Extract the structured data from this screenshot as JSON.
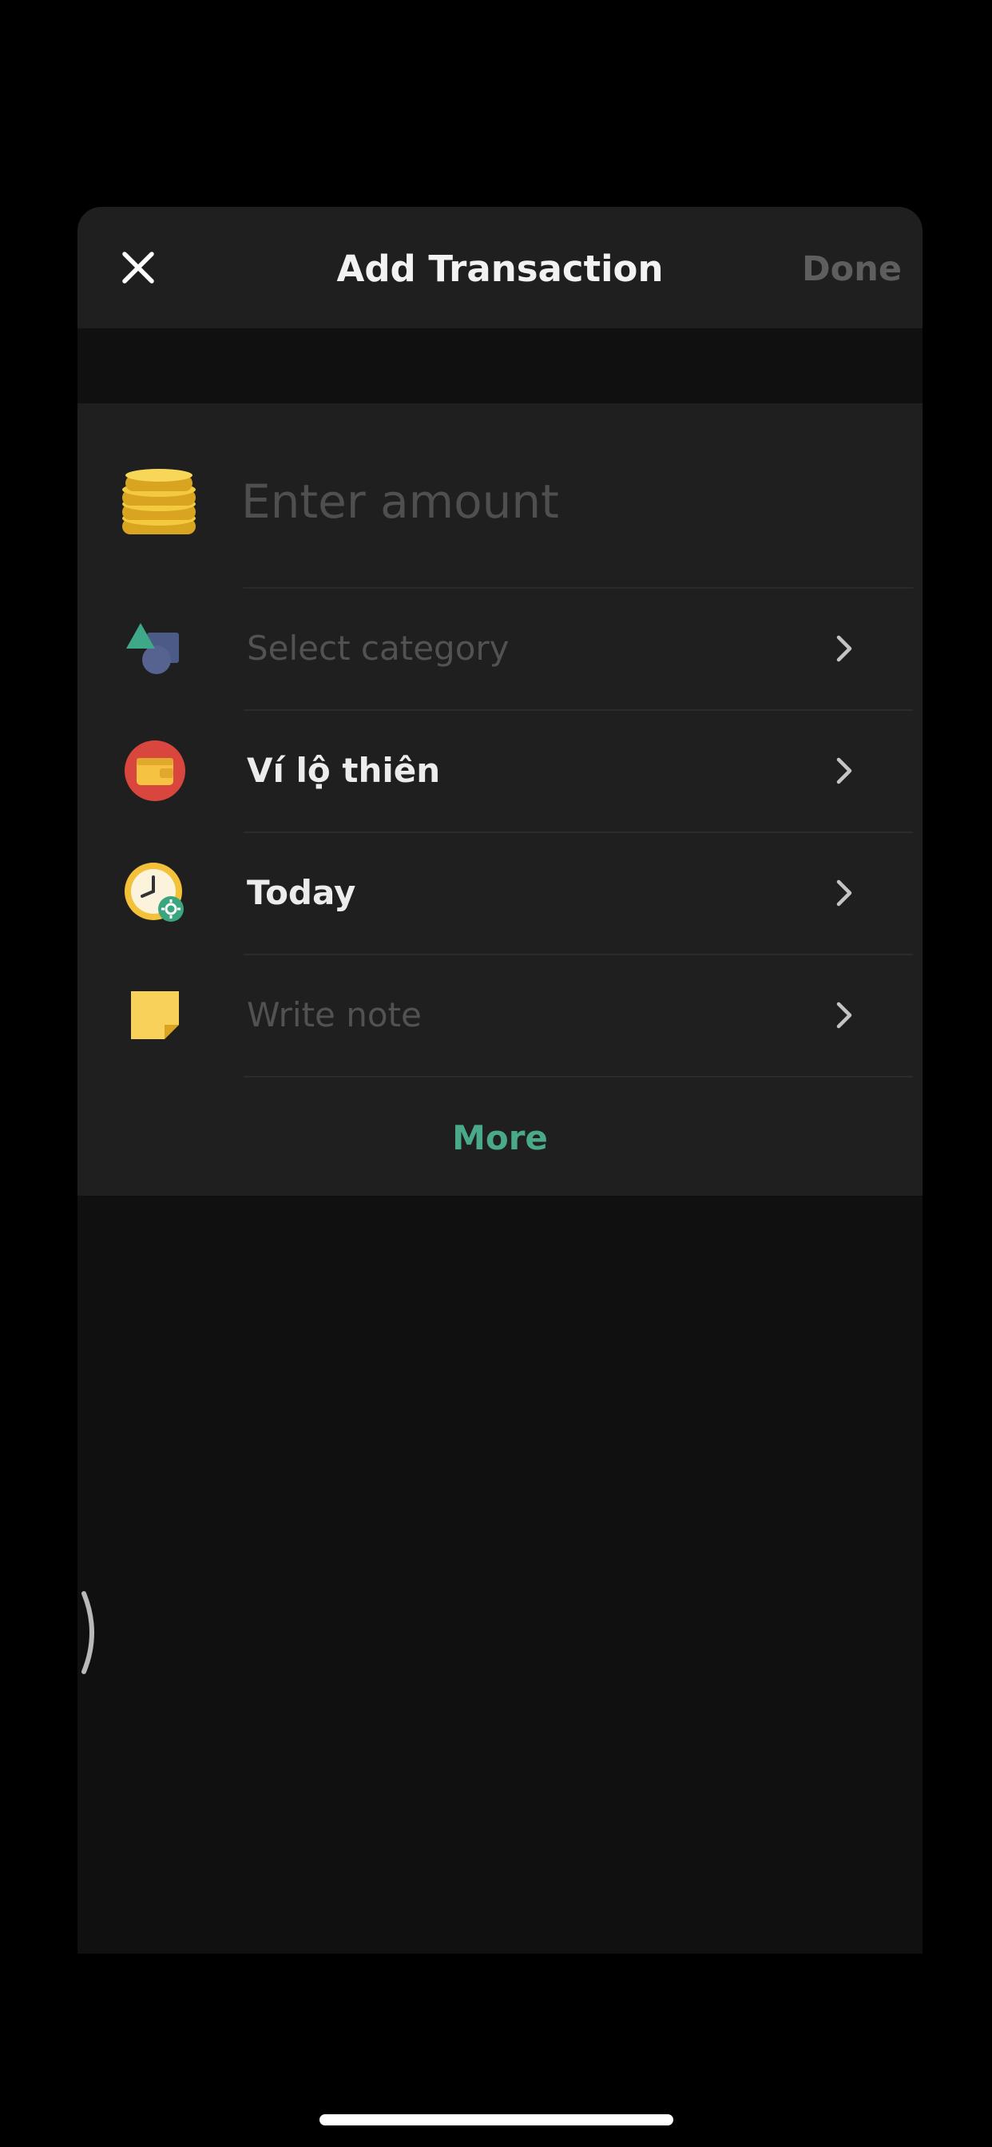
{
  "header": {
    "title": "Add Transaction",
    "done_label": "Done"
  },
  "form": {
    "amount": {
      "placeholder": "Enter amount",
      "value": ""
    },
    "rows": [
      {
        "label": "Select category",
        "state": "placeholder",
        "icon": "shapes-icon"
      },
      {
        "label": "Ví lộ thiên",
        "state": "value",
        "icon": "wallet-icon"
      },
      {
        "label": "Today",
        "state": "value",
        "icon": "clock-icon"
      },
      {
        "label": "Write note",
        "state": "placeholder",
        "icon": "note-icon"
      }
    ],
    "more_label": "More"
  },
  "colors": {
    "accent": "#4aa98a",
    "sheet_background": "#0f100f",
    "card_background": "#1e1f1e"
  }
}
